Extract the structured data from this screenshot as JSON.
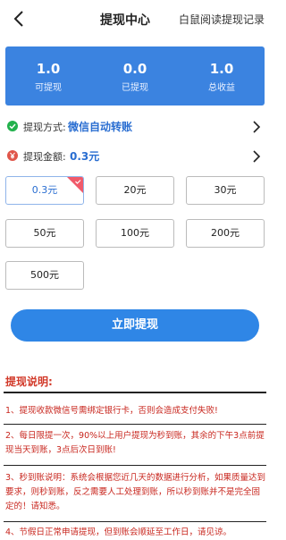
{
  "header": {
    "title": "提现中心",
    "link": "白鼠阅读提现记录"
  },
  "summary": {
    "withdrawable_value": "1.0",
    "withdrawable_label": "可提现",
    "withdrawn_value": "0.0",
    "withdrawn_label": "已提现",
    "total_value": "1.0",
    "total_label": "总收益"
  },
  "method": {
    "label": "提现方式:",
    "value": "微信自动转账"
  },
  "amount": {
    "label": "提现金额:",
    "value": "0.3元"
  },
  "amounts": [
    "0.3元",
    "20元",
    "30元",
    "50元",
    "100元",
    "200元",
    "500元"
  ],
  "cta": "立即提现",
  "notes": {
    "title": "提现说明:",
    "items": [
      "1、提现收款微信号需绑定银行卡，否则会造成支付失败!",
      "2、每日限提一次，90%以上用户提现为秒到账，其余的下午3点前提现当天到账，3点后次日到账!",
      "3、秒到账说明：系统会根据您近几天的数据进行分析，如果质量达到要求，则秒到账，反之需要人工处理到账，所以秒到账并不是完全固定的！请知悉。",
      "4、节假日正常申请提现，但到账会顺延至工作日，请见谅。"
    ]
  },
  "colors": {
    "accent": "#3b83e0",
    "link_blue": "#2a6ed1",
    "notice_red": "#c8261e"
  },
  "icons": {
    "back": "chevron-left-icon",
    "method": "check-circle-icon",
    "amount": "yen-circle-icon",
    "row_arrow": "chevron-right-icon"
  }
}
